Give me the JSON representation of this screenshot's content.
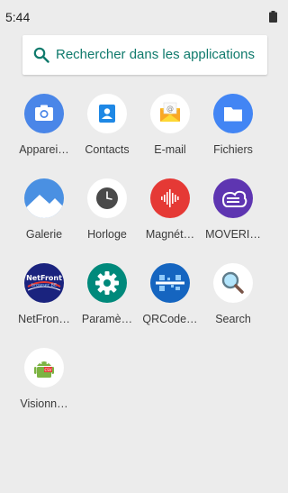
{
  "status_bar": {
    "time": "5:44"
  },
  "search": {
    "placeholder": "Rechercher dans les applications"
  },
  "apps": [
    {
      "label": "Apparei…",
      "icon": "camera-icon",
      "color": "#4a86e8"
    },
    {
      "label": "Contacts",
      "icon": "contacts-icon",
      "color": "#ffffff"
    },
    {
      "label": "E-mail",
      "icon": "email-icon",
      "color": "#ffffff"
    },
    {
      "label": "Fichiers",
      "icon": "folder-icon",
      "color": "#4285f4"
    },
    {
      "label": "Galerie",
      "icon": "gallery-icon",
      "color": "#4a90e2"
    },
    {
      "label": "Horloge",
      "icon": "clock-icon",
      "color": "#ffffff"
    },
    {
      "label": "Magnét…",
      "icon": "recorder-icon",
      "color": "#e53935"
    },
    {
      "label": "MOVERI…",
      "icon": "moverio-icon",
      "color": "#5e35b1"
    },
    {
      "label": "NetFron…",
      "icon": "netfront-icon",
      "color": "#1a237e"
    },
    {
      "label": "Paramè…",
      "icon": "settings-icon",
      "color": "#00897b"
    },
    {
      "label": "QRCode…",
      "icon": "qrcode-icon",
      "color": "#1565c0"
    },
    {
      "label": "Search",
      "icon": "search-app-icon",
      "color": "#ffffff"
    },
    {
      "label": "Visionn…",
      "icon": "viewer-icon",
      "color": "#ffffff"
    }
  ]
}
